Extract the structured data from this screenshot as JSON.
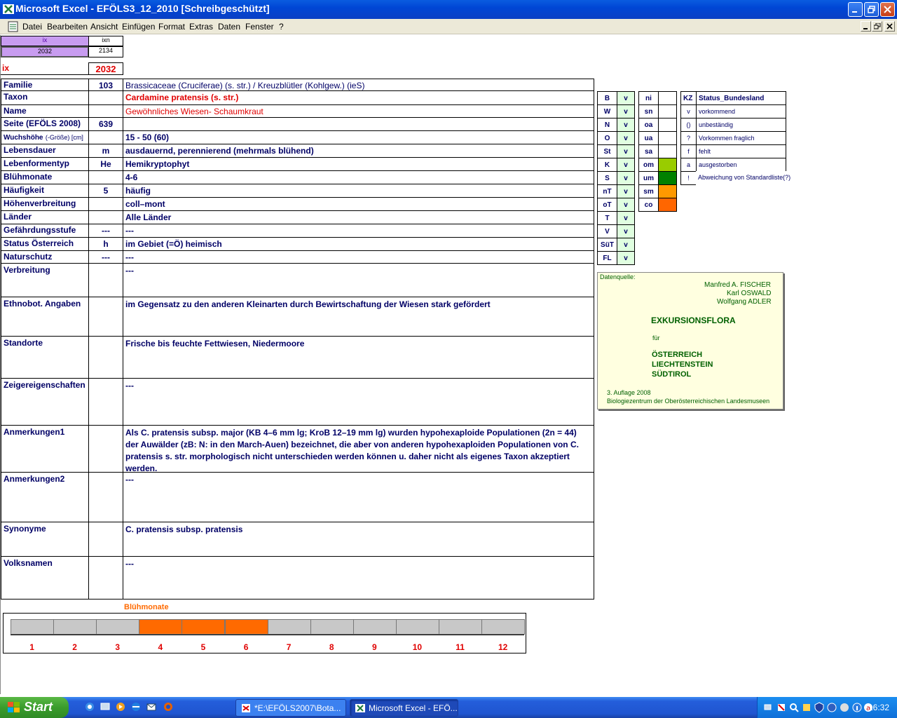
{
  "window": {
    "title": "Microsoft Excel - EFÖLS3_12_2010  [Schreibgeschützt]"
  },
  "menu": [
    "Datei",
    "Bearbeiten",
    "Ansicht",
    "Einfügen",
    "Format",
    "Extras",
    "Daten",
    "Fenster",
    "?"
  ],
  "top": {
    "ix_header": "ix",
    "ixn_header": "ixn",
    "ix_value": "2032",
    "ixn_value": "2134",
    "ix_label": "ix",
    "ix_big": "2032"
  },
  "rows": [
    {
      "label": "Familie",
      "code": "103",
      "value": "Brassicaceae (Cruciferae) (s. str.)  /  Kreuzblütler (Kohlgew.) (ieS)"
    },
    {
      "label": "Taxon",
      "code": "",
      "value": "Cardamine pratensis (s. str.)"
    },
    {
      "label": "Name",
      "code": "",
      "value": "Gewöhnliches Wiesen- Schaumkraut"
    },
    {
      "label": "Seite (EFÖLS 2008)",
      "code": "639",
      "value": ""
    },
    {
      "label": "Wuchshöhe",
      "label_small": "(-Größe) [cm]",
      "code": "",
      "value": " 15 - 50 (60)"
    },
    {
      "label": "Lebensdauer",
      "code": "m",
      "value": "ausdauernd, perennierend (mehrmals blühend)"
    },
    {
      "label": "Lebenformentyp",
      "code": "He",
      "value": "Hemikryptophyt"
    },
    {
      "label": "Blühmonate",
      "code": "",
      "value": " 4-6"
    },
    {
      "label": "Häufigkeit",
      "code": "5",
      "value": "häufig"
    },
    {
      "label": "Höhenverbreitung",
      "code": "",
      "value": "coll–mont"
    },
    {
      "label": "Länder",
      "code": "",
      "value": " Alle Länder"
    },
    {
      "label": "Gefährdungsstufe",
      "code": "---",
      "value": "  ---"
    },
    {
      "label": "Status Österreich",
      "code": "h",
      "value": "im Gebiet (=Ö) heimisch"
    },
    {
      "label": "Naturschutz",
      "code": "---",
      "value": " ---"
    }
  ],
  "big_rows": [
    {
      "label": "Verbreitung",
      "value": " ---"
    },
    {
      "label": "Ethnobot. Angaben",
      "value": "im Gegensatz zu den anderen Kleinarten durch Bewirtschaftung der Wiesen stark gefördert"
    },
    {
      "label": "Standorte",
      "value": "Frische bis feuchte Fettwiesen, Niedermoore"
    },
    {
      "label": "Zeigereigenschaften",
      "value": "---"
    },
    {
      "label": "Anmerkungen1",
      "value": "Als C. pratensis subsp. major (KB 4–6 mm lg; KroB 12–19 mm lg) wurden hypohexaploide Populationen (2n = 44) der Auwälder (zB: N: in den March-Auen) bezeichnet, die aber von anderen hypohexaploiden Populationen von C. pratensis s. str. morphologisch nicht unterschieden werden können u. daher nicht als eigenes Taxon akzeptiert werden."
    },
    {
      "label": "Anmerkungen2",
      "value": "---"
    },
    {
      "label": "Synonyme",
      "value": "C. pratensis subsp. pratensis"
    },
    {
      "label": "Volksnamen",
      "value": "---"
    }
  ],
  "states": [
    {
      "code": "B",
      "v": "v"
    },
    {
      "code": "W",
      "v": "v"
    },
    {
      "code": "N",
      "v": "v"
    },
    {
      "code": "O",
      "v": "v"
    },
    {
      "code": "St",
      "v": "v"
    },
    {
      "code": "K",
      "v": "v"
    },
    {
      "code": "S",
      "v": "v"
    },
    {
      "code": "nT",
      "v": "v"
    },
    {
      "code": "oT",
      "v": "v"
    },
    {
      "code": "T",
      "v": "v"
    },
    {
      "code": "V",
      "v": "v"
    },
    {
      "code": "SüT",
      "v": "v"
    },
    {
      "code": "FL",
      "v": "v"
    }
  ],
  "zones": [
    {
      "code": "ni",
      "color": "#ffffff"
    },
    {
      "code": "sn",
      "color": "#ffffff"
    },
    {
      "code": "oa",
      "color": "#ffffff"
    },
    {
      "code": "ua",
      "color": "#ffffff"
    },
    {
      "code": "sa",
      "color": "#ffffff"
    },
    {
      "code": "om",
      "color": "#99cc00"
    },
    {
      "code": "um",
      "color": "#008000"
    },
    {
      "code": "sm",
      "color": "#ff9900"
    },
    {
      "code": "co",
      "color": "#ff6600"
    }
  ],
  "legend": {
    "kz_header": "KZ",
    "status_header": "Status_Bundesland",
    "items": [
      {
        "kz": "v",
        "text": "vorkommend"
      },
      {
        "kz": "()",
        "text": "unbeständig"
      },
      {
        "kz": "?",
        "text": "Vorkommen fraglich"
      },
      {
        "kz": "f",
        "text": "fehlt"
      },
      {
        "kz": "a",
        "text": "ausgestorben"
      },
      {
        "kz": "!",
        "text": "Abweichung von Standardliste(?)"
      }
    ]
  },
  "source": {
    "label": "Datenquelle:",
    "author1": "Manfred A. FISCHER",
    "author2": "Karl OSWALD",
    "author3": "Wolfgang ADLER",
    "title": "EXKURSIONSFLORA",
    "fuer": "für",
    "c1": "ÖSTERREICH",
    "c2": "LIECHTENSTEIN",
    "c3": "SÜDTIROL",
    "edition": "3. Auflage 2008",
    "publisher": "Biologiezentrum der Oberösterreichischen Landesmuseen"
  },
  "chart_data": {
    "type": "bar",
    "title": "Blühmonate",
    "categories": [
      "1",
      "2",
      "3",
      "4",
      "5",
      "6",
      "7",
      "8",
      "9",
      "10",
      "11",
      "12"
    ],
    "values": [
      0,
      0,
      0,
      1,
      1,
      1,
      0,
      0,
      0,
      0,
      0,
      0
    ],
    "colors": {
      "on": "#ff6a00",
      "off": "#c8c8c8"
    }
  },
  "taskbar": {
    "start": "Start",
    "task1": "*E:\\EFÖLS2007\\Bota...",
    "task2": "Microsoft Excel - EFÖ...",
    "clock": "16:32"
  }
}
